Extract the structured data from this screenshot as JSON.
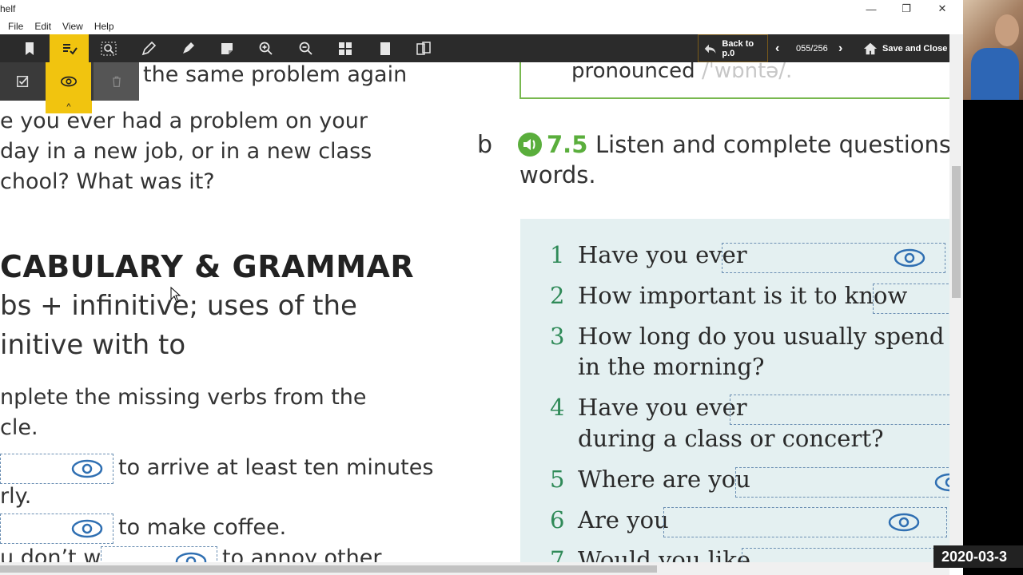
{
  "window": {
    "title": "helf",
    "minimize": "—",
    "restore": "❐",
    "close": "✕"
  },
  "menu": [
    "File",
    "Edit",
    "View",
    "Help"
  ],
  "toolbar": {
    "back_label": "Back to p.0",
    "page_indicator": "055/256",
    "save_close": "Save and Close"
  },
  "left_column": {
    "line_top": "; never had the same problem again",
    "question_lines": [
      "e you ever had a problem on your",
      "day in a new job, or in a new class",
      "chool? What was it?"
    ],
    "heading": "CABULARY & GRAMMAR",
    "subheading_lines": [
      "bs + infinitive; uses of the",
      "initive with to"
    ],
    "instruction_lines": [
      "nplete the missing verbs from the",
      "cle."
    ],
    "items": [
      {
        "text": "to arrive at least ten minutes",
        "cont": "rly."
      },
      {
        "text": "to make coffee.",
        "cont": ""
      },
      {
        "text_pre": "u don’t w",
        "text": "to annoy other",
        "cont": ""
      }
    ]
  },
  "right_column": {
    "pron_word": "pronounced",
    "pron_ipa": "/ˈwɒntə/.",
    "exercise_letter": "b",
    "track": "7.5",
    "instruction": "Listen and complete questions",
    "instruction_cont": "words.",
    "questions": [
      {
        "num": "1",
        "text": "Have you ever",
        "cont": ""
      },
      {
        "num": "2",
        "text": "How important is it to know",
        "cont": ""
      },
      {
        "num": "3",
        "text": "How long do you usually spend deci",
        "cont": "in the morning?"
      },
      {
        "num": "4",
        "text": "Have you ever",
        "cont": "during a class or concert?"
      },
      {
        "num": "5",
        "text": "Where are you",
        "cont": ""
      },
      {
        "num": "6",
        "text": "Are you",
        "cont": ""
      },
      {
        "num": "7",
        "text": "Would you like",
        "cont": ""
      }
    ]
  },
  "overlay": {
    "date": "2020-03-3"
  },
  "colors": {
    "accent": "#f1c40f",
    "green": "#5aae3c",
    "panel": "#e4f0f1"
  }
}
